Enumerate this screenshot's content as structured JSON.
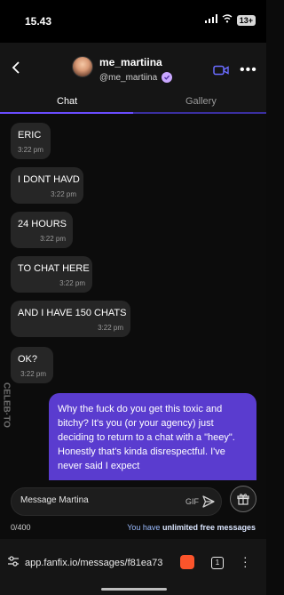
{
  "status": {
    "time": "15.43",
    "battery": "13+"
  },
  "header": {
    "username": "me_martiina",
    "handle": "@me_martiina"
  },
  "tabs": [
    {
      "label": "Chat"
    },
    {
      "label": "Gallery"
    }
  ],
  "messages": [
    {
      "text": "ERIC",
      "time": "3:22 pm"
    },
    {
      "text": "I DONT HAVD",
      "time": "3:22 pm"
    },
    {
      "text": "24 HOURS",
      "time": "3:22 pm"
    },
    {
      "text": "TO CHAT HERE",
      "time": "3:22 pm"
    },
    {
      "text": "AND I HAVE 150 CHATS",
      "time": "3:22 pm"
    },
    {
      "text": "OK?",
      "time": "3:22 pm"
    }
  ],
  "outgoing": {
    "text": "Why the fuck do you get this toxic and bitchy? It's you (or your agency) just deciding to return to a chat with a \"heey\". Honestly that's kinda disrespectful. I've never said I expect"
  },
  "watermark": "CELEB·TO",
  "composer": {
    "placeholder": "Message Martina",
    "gif_label": "GIF"
  },
  "footer": {
    "counter": "0/400",
    "free_prefix": "You have ",
    "free_strong": "unlimited free messages"
  },
  "browser": {
    "url": "app.fanfix.io/messages/f81ea73",
    "tab_count": "1"
  },
  "colors": {
    "accent": "#6a4cff",
    "outgoing_bubble": "#5a3ccf"
  }
}
